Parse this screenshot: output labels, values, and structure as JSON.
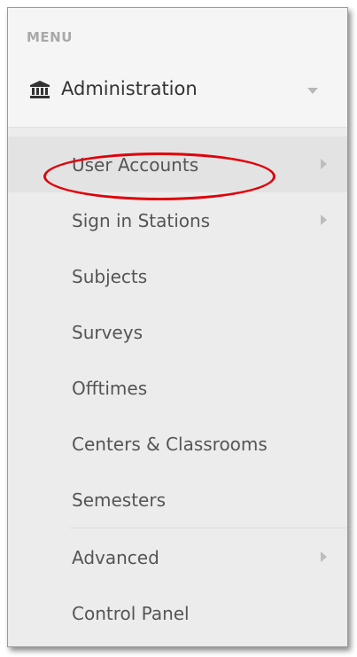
{
  "menu": {
    "header": "MENU"
  },
  "section": {
    "label": "Administration",
    "icon": "bank-icon",
    "caret_icon": "chevron-down-icon"
  },
  "items": [
    {
      "label": "User Accounts",
      "has_submenu": true,
      "active": true
    },
    {
      "label": "Sign in Stations",
      "has_submenu": true,
      "active": false
    },
    {
      "label": "Subjects",
      "has_submenu": false,
      "active": false
    },
    {
      "label": "Surveys",
      "has_submenu": false,
      "active": false
    },
    {
      "label": "Offtimes",
      "has_submenu": false,
      "active": false
    },
    {
      "label": "Centers & Classrooms",
      "has_submenu": false,
      "active": false
    },
    {
      "label": "Semesters",
      "has_submenu": false,
      "active": false
    },
    {
      "label": "Advanced",
      "has_submenu": true,
      "active": false
    },
    {
      "label": "Control Panel",
      "has_submenu": false,
      "active": false
    }
  ],
  "annotation": {
    "color": "#e0000a",
    "target": "User Accounts"
  },
  "colors": {
    "panel_bg": "#f5f5f5",
    "submenu_bg": "#ececec",
    "active_bg": "#e3e3e3",
    "text": "#555555",
    "header_text": "#a9a9a9"
  }
}
